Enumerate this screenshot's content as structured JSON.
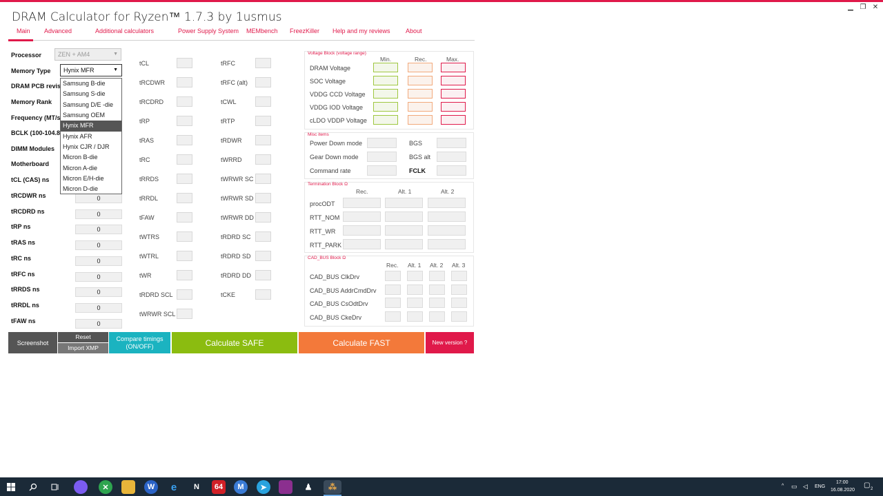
{
  "window": {
    "title": "DRAM Calculator for Ryzen™ 1.7.3 by 1usmus",
    "minimize": "▁",
    "restore": "❐",
    "close": "✕"
  },
  "nav": {
    "tabs": [
      "Main",
      "Advanced",
      "Additional calculators",
      "Power Supply System",
      "MEMbench",
      "FreezKiller",
      "Help and my reviews",
      "About"
    ]
  },
  "left": {
    "processor_label": "Processor",
    "processor_value": "ZEN + AM4",
    "memory_type_label": "Memory Type",
    "memory_type_value": "Hynix MFR",
    "pcb_label": "DRAM PCB revis",
    "rank_label": "Memory Rank",
    "freq_label": "Frequency (MT/s",
    "bclk_label": "BCLK (100-104.8",
    "dimm_label": "DIMM Modules",
    "mobo_label": "Motherboard",
    "ns_fields": [
      {
        "label": "tCL (CAS) ns",
        "value": "0"
      },
      {
        "label": "tRCDWR ns",
        "value": "0"
      },
      {
        "label": "tRCDRD ns",
        "value": "0"
      },
      {
        "label": "tRP ns",
        "value": "0"
      },
      {
        "label": "tRAS ns",
        "value": "0"
      },
      {
        "label": "tRC ns",
        "value": "0"
      },
      {
        "label": "tRFC ns",
        "value": "0"
      },
      {
        "label": "tRRDS ns",
        "value": "0"
      },
      {
        "label": "tRRDL ns",
        "value": "0"
      },
      {
        "label": "tFAW ns",
        "value": "0"
      }
    ]
  },
  "dropdown": {
    "options": [
      "Samsung B-die",
      "Samsung S-die",
      "Samsung D/E -die",
      "Samsung OEM",
      "Hynix MFR",
      "Hynix AFR",
      "Hynix CJR / DJR",
      "Micron B-die",
      "Micron A-die",
      "Micron E/H-die",
      "Micron D-die"
    ],
    "selected_index": 4
  },
  "timings_col1": [
    "tCL",
    "tRCDWR",
    "tRCDRD",
    "tRP",
    "tRAS",
    "tRC",
    "tRRDS",
    "tRRDL",
    "tFAW",
    "tWTRS",
    "tWTRL",
    "tWR",
    "tRDRD SCL",
    "tWRWR SCL"
  ],
  "timings_col2": [
    "tRFC",
    "tRFC (alt)",
    "tCWL",
    "tRTP",
    "tRDWR",
    "tWRRD",
    "tWRWR SC",
    "tWRWR SD",
    "tWRWR DD",
    "tRDRD SC",
    "tRDRD SD",
    "tRDRD DD",
    "tCKE"
  ],
  "voltage": {
    "title": "Voltage Block (voltage range)",
    "headers": [
      "Min.",
      "Rec.",
      "Max."
    ],
    "rows": [
      "DRAM Voltage",
      "SOC Voltage",
      "VDDG  CCD Voltage",
      "VDDG  IOD Voltage",
      "cLDO VDDP Voltage"
    ]
  },
  "misc": {
    "title": "Misc items",
    "left": [
      "Power Down mode",
      "Gear Down mode",
      "Command rate"
    ],
    "right": [
      "BGS",
      "BGS alt",
      "FCLK"
    ]
  },
  "termination": {
    "title": "Termination Block Ω",
    "headers": [
      "Rec.",
      "Alt. 1",
      "Alt. 2"
    ],
    "rows": [
      "procODT",
      "RTT_NOM",
      "RTT_WR",
      "RTT_PARK"
    ]
  },
  "cadbus": {
    "title": "CAD_BUS Block Ω",
    "headers": [
      "Rec.",
      "Alt. 1",
      "Alt. 2",
      "Alt. 3"
    ],
    "rows": [
      "CAD_BUS ClkDrv",
      "CAD_BUS AddrCmdDrv",
      "CAD_BUS CsOdtDrv",
      "CAD_BUS CkeDrv"
    ]
  },
  "buttons": {
    "screenshot": "Screenshot",
    "reset": "Reset",
    "import_xmp": "Import XMP",
    "compare_line1": "Compare timings",
    "compare_line2": "(ON/OFF)",
    "calc_safe": "Calculate SAFE",
    "calc_fast": "Calculate FAST",
    "new_version": "New version ?"
  },
  "colors": {
    "accent": "#e0194a",
    "safe": "#8bbc10",
    "fast": "#f3793a",
    "compare": "#1bb3c0",
    "dark_btn": "#555555"
  },
  "taskbar": {
    "lang": "ENG",
    "time": "17:00",
    "date": "16.08.2020",
    "notif_count": "2",
    "tray_arrow": "^"
  }
}
